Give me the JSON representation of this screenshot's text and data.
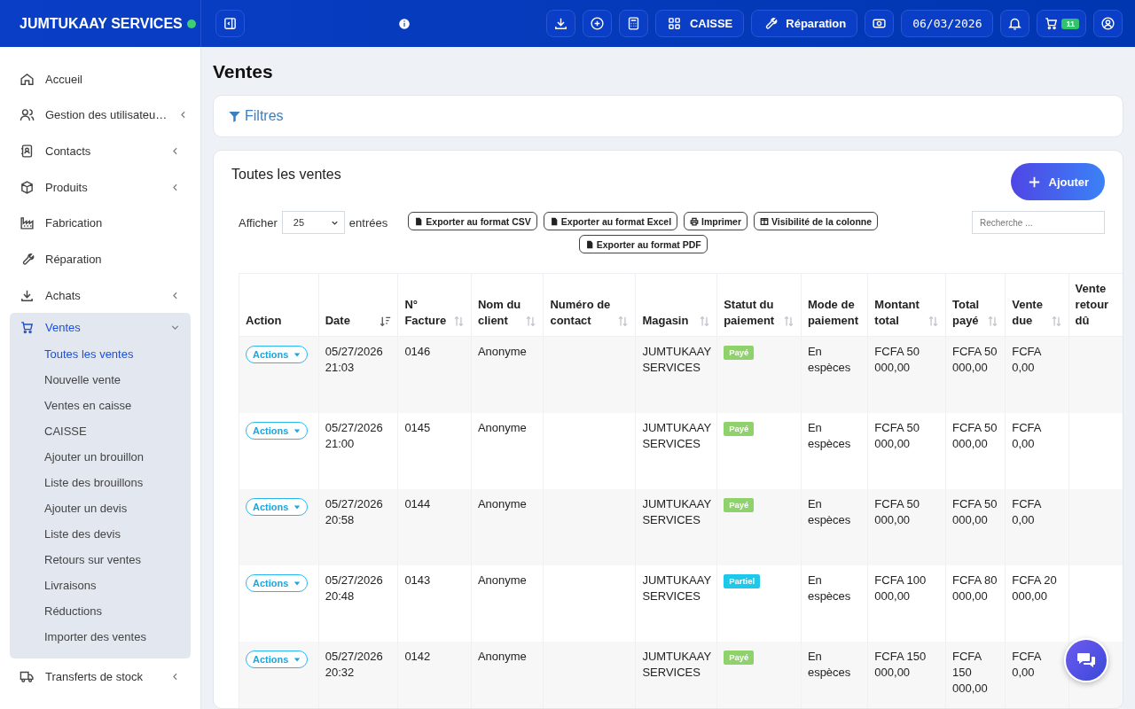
{
  "header": {
    "brand": "JUMTUKAAY SERVICES",
    "online": true,
    "buttons": [
      {
        "kind": "download"
      },
      {
        "kind": "add"
      },
      {
        "kind": "calculator"
      },
      {
        "kind": "grid",
        "label": "CAISSE"
      },
      {
        "kind": "wrench",
        "label": "Réparation"
      },
      {
        "kind": "money"
      },
      {
        "kind": "date",
        "label": "06/03/2026"
      },
      {
        "kind": "bell"
      },
      {
        "kind": "cart",
        "badge": "11"
      },
      {
        "kind": "user"
      }
    ]
  },
  "sidebar": {
    "items": [
      {
        "label": "Accueil",
        "kind": "link",
        "selected": false
      },
      {
        "label": "Gestion des utilisateu…",
        "kind": "group",
        "expanded": false,
        "selected": false
      },
      {
        "label": "Contacts",
        "kind": "group",
        "expanded": false,
        "selected": false
      },
      {
        "label": "Produits",
        "kind": "group",
        "expanded": false,
        "selected": false
      },
      {
        "label": "Fabrication",
        "kind": "link",
        "selected": false
      },
      {
        "label": "Réparation",
        "kind": "link",
        "selected": false
      },
      {
        "label": "Achats",
        "kind": "group",
        "expanded": false,
        "selected": false
      },
      {
        "label": "Ventes",
        "kind": "group",
        "expanded": true,
        "selected": true,
        "children": [
          {
            "label": "Toutes les ventes",
            "selected": true
          },
          {
            "label": "Nouvelle vente",
            "selected": false
          },
          {
            "label": "Ventes en caisse",
            "selected": false
          },
          {
            "label": "CAISSE",
            "selected": false
          },
          {
            "label": "Ajouter un brouillon",
            "selected": false
          },
          {
            "label": "Liste des brouillons",
            "selected": false
          },
          {
            "label": "Ajouter un devis",
            "selected": false
          },
          {
            "label": "Liste des devis",
            "selected": false
          },
          {
            "label": "Retours sur ventes",
            "selected": false
          },
          {
            "label": "Livraisons",
            "selected": false
          },
          {
            "label": "Réductions",
            "selected": false
          },
          {
            "label": "Importer des ventes",
            "selected": false
          }
        ]
      },
      {
        "label": "Transferts de stock",
        "kind": "group",
        "expanded": false,
        "selected": false
      }
    ]
  },
  "page": {
    "title": "Ventes",
    "filters": "Filtres"
  },
  "card": {
    "title": "Toutes les ventes",
    "add_button": "Ajouter",
    "show_label": "Afficher",
    "page_size": "25",
    "entries_label": "entrées",
    "search": {
      "placeholder": "Recherche ..."
    },
    "exports": [
      {
        "label": "Exporter au format CSV",
        "kind": "export"
      },
      {
        "label": "Exporter au format Excel",
        "kind": "export"
      },
      {
        "label": "Imprimer",
        "kind": "print"
      },
      {
        "label": "Visibilité de la colonne",
        "kind": "columns"
      },
      {
        "label": "Exporter au format PDF",
        "kind": "export"
      }
    ]
  },
  "table": {
    "columns": [
      {
        "label": "Action",
        "sortable": false
      },
      {
        "label": "Date",
        "sorted": true,
        "sortable": true
      },
      {
        "label": "N° Facture",
        "sorted": false,
        "sortable": true
      },
      {
        "label": "Nom du client",
        "sorted": false,
        "sortable": true
      },
      {
        "label": "Numéro de contact",
        "sorted": false,
        "sortable": true
      },
      {
        "label": "Magasin",
        "sorted": false,
        "sortable": true
      },
      {
        "label": "Statut du paiement",
        "sorted": false,
        "sortable": true
      },
      {
        "label": "Mode de paiement",
        "sortable": false
      },
      {
        "label": "Montant total",
        "sorted": false,
        "sortable": true
      },
      {
        "label": "Total payé",
        "sorted": false,
        "sortable": true
      },
      {
        "label": "Vente due",
        "sorted": false,
        "sortable": true
      },
      {
        "label": "Vente retour dû",
        "sortable": false
      }
    ],
    "rows": [
      {
        "action": "Actions",
        "date": "05/27/2026 21:03",
        "invoice": "0146",
        "client": "Anonyme",
        "store": "JUMTUKAAY SERVICES",
        "status": "Payé",
        "color": "#8fd16a",
        "mode": "En espèces",
        "total": "FCFA 50 000,00",
        "paid": "FCFA 50 000,00",
        "due": "FCFA 0,00"
      },
      {
        "action": "Actions",
        "date": "05/27/2026 21:00",
        "invoice": "0145",
        "client": "Anonyme",
        "store": "JUMTUKAAY SERVICES",
        "status": "Payé",
        "color": "#8fd16a",
        "mode": "En espèces",
        "total": "FCFA 50 000,00",
        "paid": "FCFA 50 000,00",
        "due": "FCFA 0,00"
      },
      {
        "action": "Actions",
        "date": "05/27/2026 20:58",
        "invoice": "0144",
        "client": "Anonyme",
        "store": "JUMTUKAAY SERVICES",
        "status": "Payé",
        "color": "#8fd16a",
        "mode": "En espèces",
        "total": "FCFA 50 000,00",
        "paid": "FCFA 50 000,00",
        "due": "FCFA 0,00"
      },
      {
        "action": "Actions",
        "date": "05/27/2026 20:48",
        "invoice": "0143",
        "client": "Anonyme",
        "store": "JUMTUKAAY SERVICES",
        "status": "Partiel",
        "color": "#1ec8ea",
        "mode": "En espèces",
        "total": "FCFA 100 000,00",
        "paid": "FCFA 80 000,00",
        "due": "FCFA 20 000,00"
      },
      {
        "action": "Actions",
        "date": "05/27/2026 20:32",
        "invoice": "0142",
        "client": "Anonyme",
        "store": "JUMTUKAAY SERVICES",
        "status": "Payé",
        "color": "#8fd16a",
        "mode": "En espèces",
        "total": "FCFA 150 000,00",
        "paid": "FCFA 150 000,00",
        "due": "FCFA 0,00"
      }
    ]
  }
}
